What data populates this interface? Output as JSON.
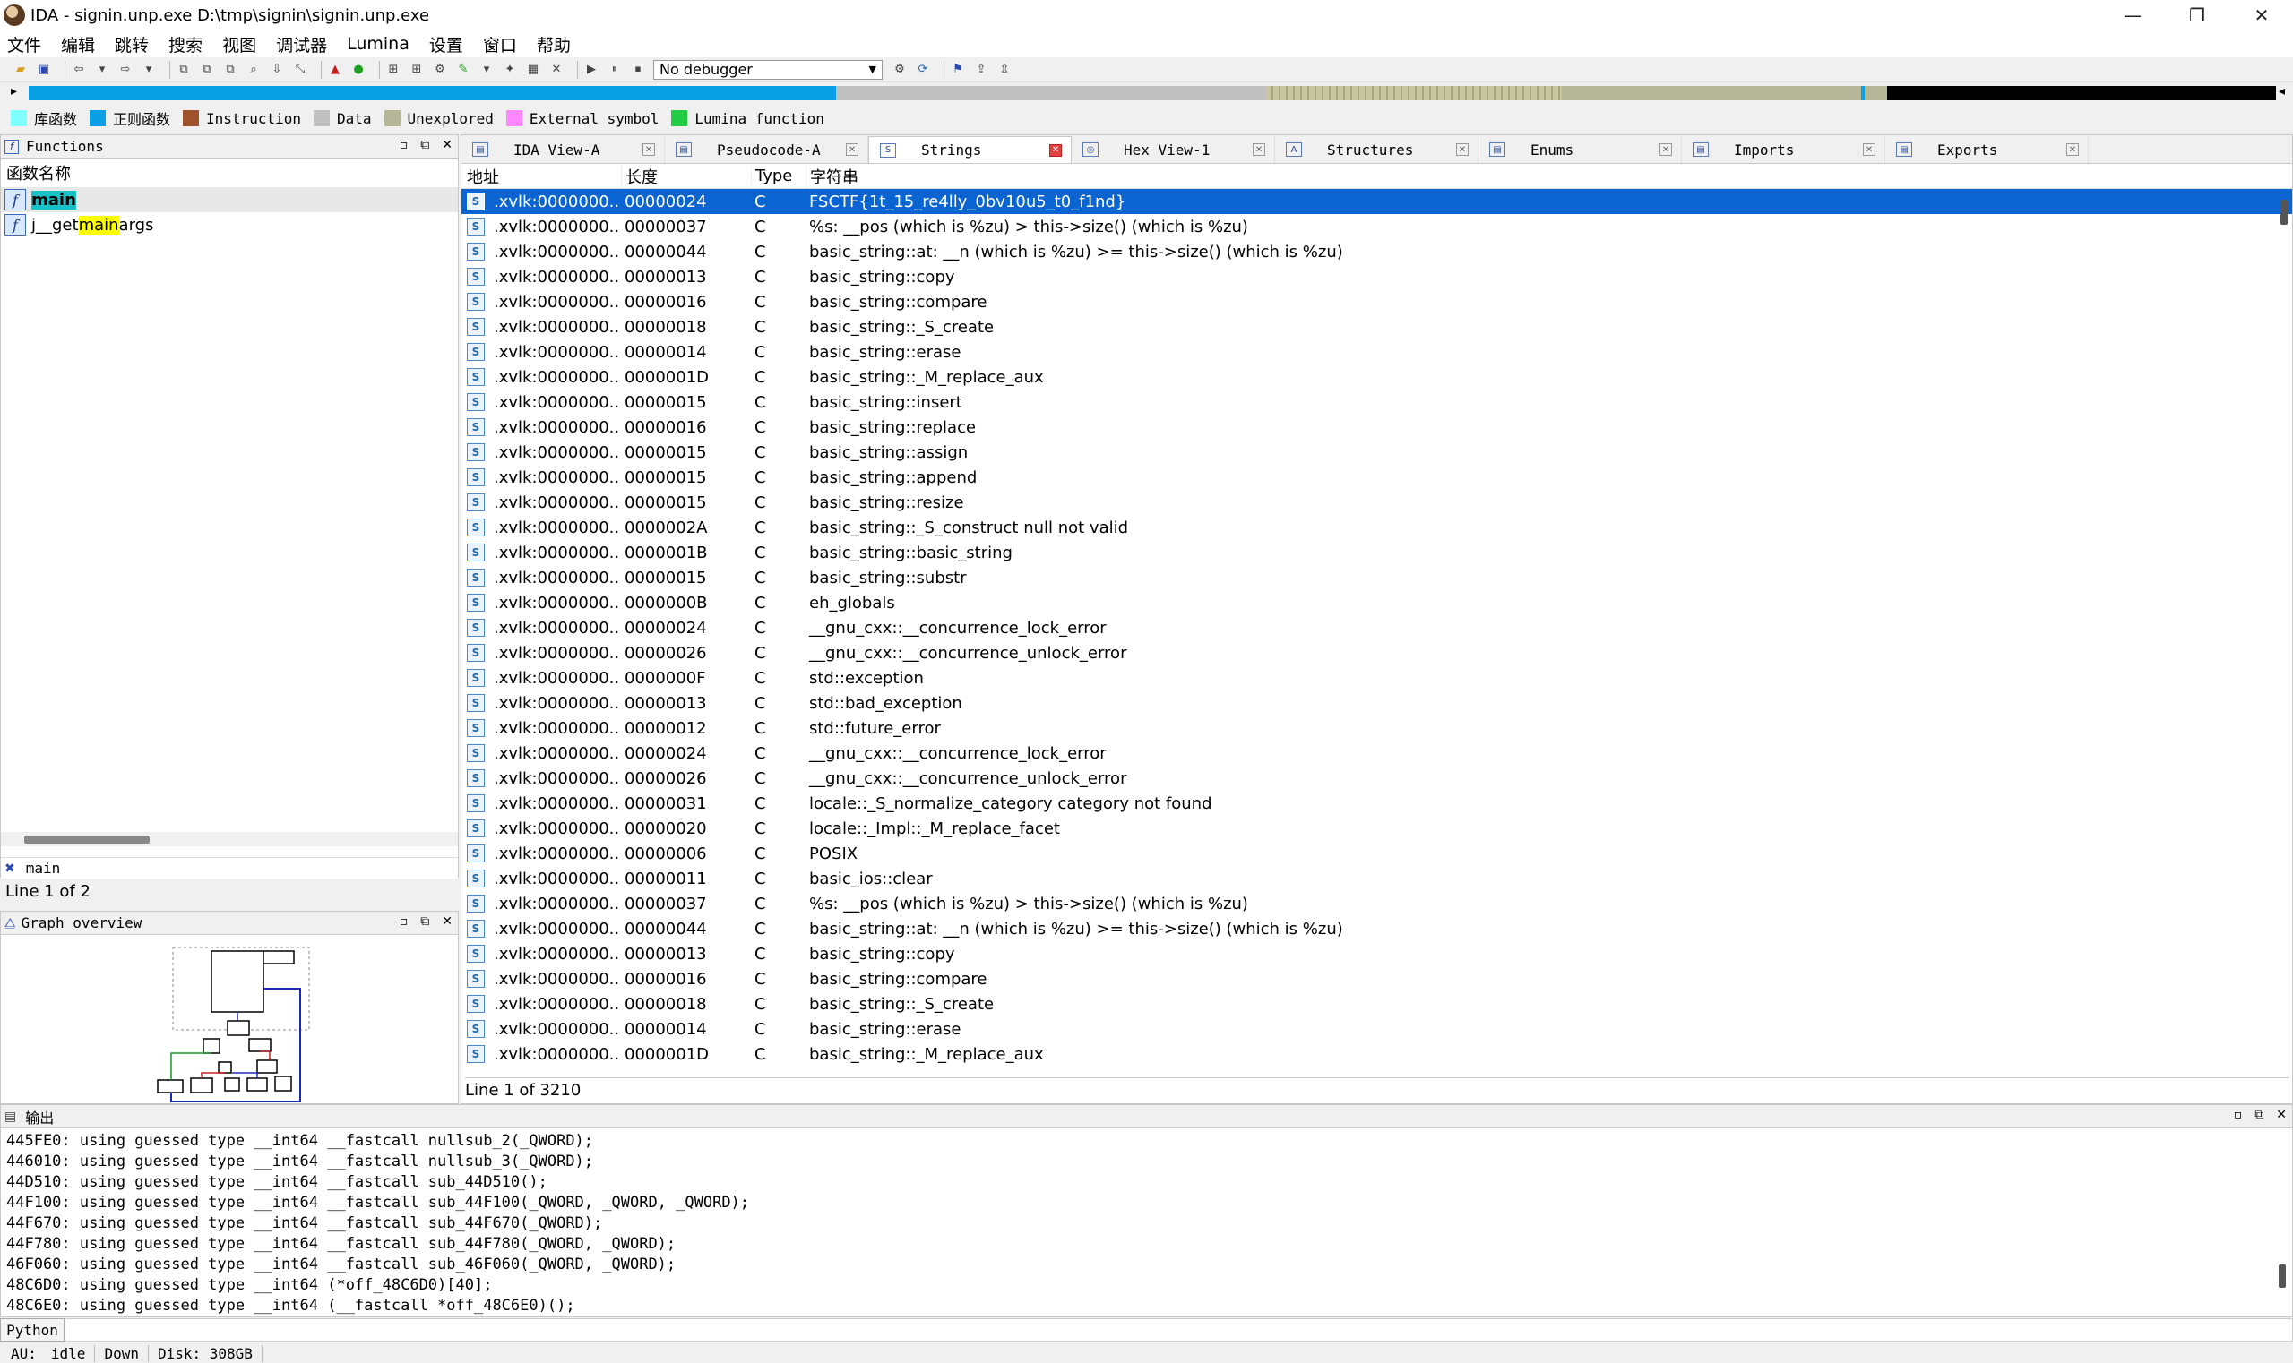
{
  "window": {
    "title": "IDA - signin.unp.exe D:\\tmp\\signin\\signin.unp.exe",
    "minimize_glyph": "—",
    "restore_glyph": "❐",
    "close_glyph": "✕"
  },
  "menu": [
    "文件",
    "编辑",
    "跳转",
    "搜索",
    "视图",
    "调试器",
    "Lumina",
    "设置",
    "窗口",
    "帮助"
  ],
  "toolbar": {
    "debugger_value": "No debugger"
  },
  "legend": [
    {
      "label": "库函数",
      "color": "#7fffff"
    },
    {
      "label": "正则函数",
      "color": "#0aa0e6"
    },
    {
      "label": "Instruction",
      "color": "#a0522d"
    },
    {
      "label": "Data",
      "color": "#c0c0c0"
    },
    {
      "label": "Unexplored",
      "color": "#b5b598"
    },
    {
      "label": "External symbol",
      "color": "#ff88ff"
    },
    {
      "label": "Lumina function",
      "color": "#22cc44"
    }
  ],
  "functions": {
    "title": "Functions",
    "column": "函数名称",
    "items": [
      {
        "pre": "",
        "hl": "main",
        "post": "",
        "selected": true
      },
      {
        "pre": "j__get",
        "hl": "main",
        "post": "args",
        "selected": false
      }
    ],
    "filter": "main",
    "status": "Line 1 of 2"
  },
  "graph": {
    "title": "Graph overview"
  },
  "tabs": [
    {
      "label": "IDA View-A",
      "icon": "▤",
      "active": false
    },
    {
      "label": "Pseudocode-A",
      "icon": "▤",
      "active": false
    },
    {
      "label": "Strings",
      "icon": "S",
      "active": true
    },
    {
      "label": "Hex View-1",
      "icon": "◎",
      "active": false
    },
    {
      "label": "Structures",
      "icon": "A",
      "active": false
    },
    {
      "label": "Enums",
      "icon": "▤",
      "active": false
    },
    {
      "label": "Imports",
      "icon": "▤",
      "active": false
    },
    {
      "label": "Exports",
      "icon": "▤",
      "active": false
    }
  ],
  "strings": {
    "headers": {
      "addr": "地址",
      "len": "长度",
      "type": "Type",
      "str": "字符串"
    },
    "rows": [
      {
        "addr": ".xvlk:0000000...",
        "len": "00000024",
        "type": "C",
        "str": "FSCTF{1t_15_re4lly_0bv10u5_t0_f1nd}"
      },
      {
        "addr": ".xvlk:0000000...",
        "len": "00000037",
        "type": "C",
        "str": "%s: __pos (which is %zu) > this->size() (which is %zu)"
      },
      {
        "addr": ".xvlk:0000000...",
        "len": "00000044",
        "type": "C",
        "str": "basic_string::at: __n (which is %zu) >= this->size() (which is %zu)"
      },
      {
        "addr": ".xvlk:0000000...",
        "len": "00000013",
        "type": "C",
        "str": "basic_string::copy"
      },
      {
        "addr": ".xvlk:0000000...",
        "len": "00000016",
        "type": "C",
        "str": "basic_string::compare"
      },
      {
        "addr": ".xvlk:0000000...",
        "len": "00000018",
        "type": "C",
        "str": "basic_string::_S_create"
      },
      {
        "addr": ".xvlk:0000000...",
        "len": "00000014",
        "type": "C",
        "str": "basic_string::erase"
      },
      {
        "addr": ".xvlk:0000000...",
        "len": "0000001D",
        "type": "C",
        "str": "basic_string::_M_replace_aux"
      },
      {
        "addr": ".xvlk:0000000...",
        "len": "00000015",
        "type": "C",
        "str": "basic_string::insert"
      },
      {
        "addr": ".xvlk:0000000...",
        "len": "00000016",
        "type": "C",
        "str": "basic_string::replace"
      },
      {
        "addr": ".xvlk:0000000...",
        "len": "00000015",
        "type": "C",
        "str": "basic_string::assign"
      },
      {
        "addr": ".xvlk:0000000...",
        "len": "00000015",
        "type": "C",
        "str": "basic_string::append"
      },
      {
        "addr": ".xvlk:0000000...",
        "len": "00000015",
        "type": "C",
        "str": "basic_string::resize"
      },
      {
        "addr": ".xvlk:0000000...",
        "len": "0000002A",
        "type": "C",
        "str": "basic_string::_S_construct null not valid"
      },
      {
        "addr": ".xvlk:0000000...",
        "len": "0000001B",
        "type": "C",
        "str": "basic_string::basic_string"
      },
      {
        "addr": ".xvlk:0000000...",
        "len": "00000015",
        "type": "C",
        "str": "basic_string::substr"
      },
      {
        "addr": ".xvlk:0000000...",
        "len": "0000000B",
        "type": "C",
        "str": "eh_globals"
      },
      {
        "addr": ".xvlk:0000000...",
        "len": "00000024",
        "type": "C",
        "str": "__gnu_cxx::__concurrence_lock_error"
      },
      {
        "addr": ".xvlk:0000000...",
        "len": "00000026",
        "type": "C",
        "str": "__gnu_cxx::__concurrence_unlock_error"
      },
      {
        "addr": ".xvlk:0000000...",
        "len": "0000000F",
        "type": "C",
        "str": "std::exception"
      },
      {
        "addr": ".xvlk:0000000...",
        "len": "00000013",
        "type": "C",
        "str": "std::bad_exception"
      },
      {
        "addr": ".xvlk:0000000...",
        "len": "00000012",
        "type": "C",
        "str": "std::future_error"
      },
      {
        "addr": ".xvlk:0000000...",
        "len": "00000024",
        "type": "C",
        "str": "__gnu_cxx::__concurrence_lock_error"
      },
      {
        "addr": ".xvlk:0000000...",
        "len": "00000026",
        "type": "C",
        "str": "__gnu_cxx::__concurrence_unlock_error"
      },
      {
        "addr": ".xvlk:0000000...",
        "len": "00000031",
        "type": "C",
        "str": "locale::_S_normalize_category category not found"
      },
      {
        "addr": ".xvlk:0000000...",
        "len": "00000020",
        "type": "C",
        "str": "locale::_Impl::_M_replace_facet"
      },
      {
        "addr": ".xvlk:0000000...",
        "len": "00000006",
        "type": "C",
        "str": "POSIX"
      },
      {
        "addr": ".xvlk:0000000...",
        "len": "00000011",
        "type": "C",
        "str": "basic_ios::clear"
      },
      {
        "addr": ".xvlk:0000000...",
        "len": "00000037",
        "type": "C",
        "str": "%s: __pos (which is %zu) > this->size() (which is %zu)"
      },
      {
        "addr": ".xvlk:0000000...",
        "len": "00000044",
        "type": "C",
        "str": "basic_string::at: __n (which is %zu) >= this->size() (which is %zu)"
      },
      {
        "addr": ".xvlk:0000000...",
        "len": "00000013",
        "type": "C",
        "str": "basic_string::copy"
      },
      {
        "addr": ".xvlk:0000000...",
        "len": "00000016",
        "type": "C",
        "str": "basic_string::compare"
      },
      {
        "addr": ".xvlk:0000000...",
        "len": "00000018",
        "type": "C",
        "str": "basic_string::_S_create"
      },
      {
        "addr": ".xvlk:0000000...",
        "len": "00000014",
        "type": "C",
        "str": "basic_string::erase"
      },
      {
        "addr": ".xvlk:0000000...",
        "len": "0000001D",
        "type": "C",
        "str": "basic_string::_M_replace_aux"
      }
    ],
    "status": "Line 1 of 3210"
  },
  "output": {
    "title": "输出",
    "lines": [
      "445FE0: using guessed type __int64 __fastcall nullsub_2(_QWORD);",
      "446010: using guessed type __int64 __fastcall nullsub_3(_QWORD);",
      "44D510: using guessed type __int64 __fastcall sub_44D510();",
      "44F100: using guessed type __int64 __fastcall sub_44F100(_QWORD, _QWORD, _QWORD);",
      "44F670: using guessed type __int64 __fastcall sub_44F670(_QWORD);",
      "44F780: using guessed type __int64 __fastcall sub_44F780(_QWORD, _QWORD);",
      "46F060: using guessed type __int64 __fastcall sub_46F060(_QWORD, _QWORD);",
      "48C6D0: using guessed type __int64 (*off_48C6D0)[40];",
      "48C6E0: using guessed type __int64 (__fastcall *off_48C6E0)();"
    ]
  },
  "python_label": "Python",
  "status": {
    "au": "AU:",
    "state": "idle",
    "dir": "Down",
    "disk": "Disk: 308GB"
  }
}
